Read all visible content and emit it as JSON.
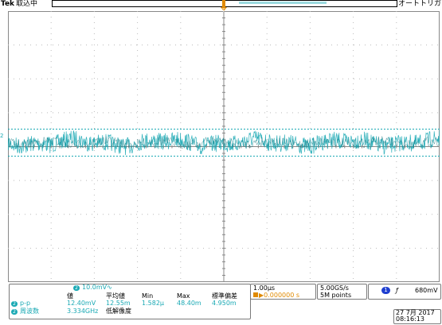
{
  "header": {
    "brand": "Tek",
    "status": "取込中",
    "trigger_mode": "オートトリガ",
    "trigger_pos_label": "T"
  },
  "channel": {
    "number": "2",
    "marker": "2",
    "scale": "10.0mV∿",
    "color": "#1aa9b4"
  },
  "measurements": {
    "headers": [
      "値",
      "平均値",
      "Min",
      "Max",
      "標準偏差"
    ],
    "rows": [
      {
        "ch": "2",
        "label": "p-p",
        "values": [
          "12.40mV",
          "12.55m",
          "1.582μ",
          "48.40m",
          "4.950m"
        ]
      },
      {
        "ch": "2",
        "label": "周波数",
        "values": [
          "3.334GHz",
          "低解像度",
          "",
          "",
          ""
        ]
      }
    ]
  },
  "timebase": {
    "scale": "1.00μs",
    "position": "▶0.000000 s",
    "position_icon": "t-marker-icon"
  },
  "acquisition": {
    "sample_rate": "5.00GS/s",
    "record_length": "5M points"
  },
  "trigger": {
    "source": "1",
    "slope_icon": "rising-edge-icon",
    "slope": "ƒ",
    "level": "680mV"
  },
  "datetime": {
    "date": "27 7月  2017",
    "time": "08:16:13"
  }
}
